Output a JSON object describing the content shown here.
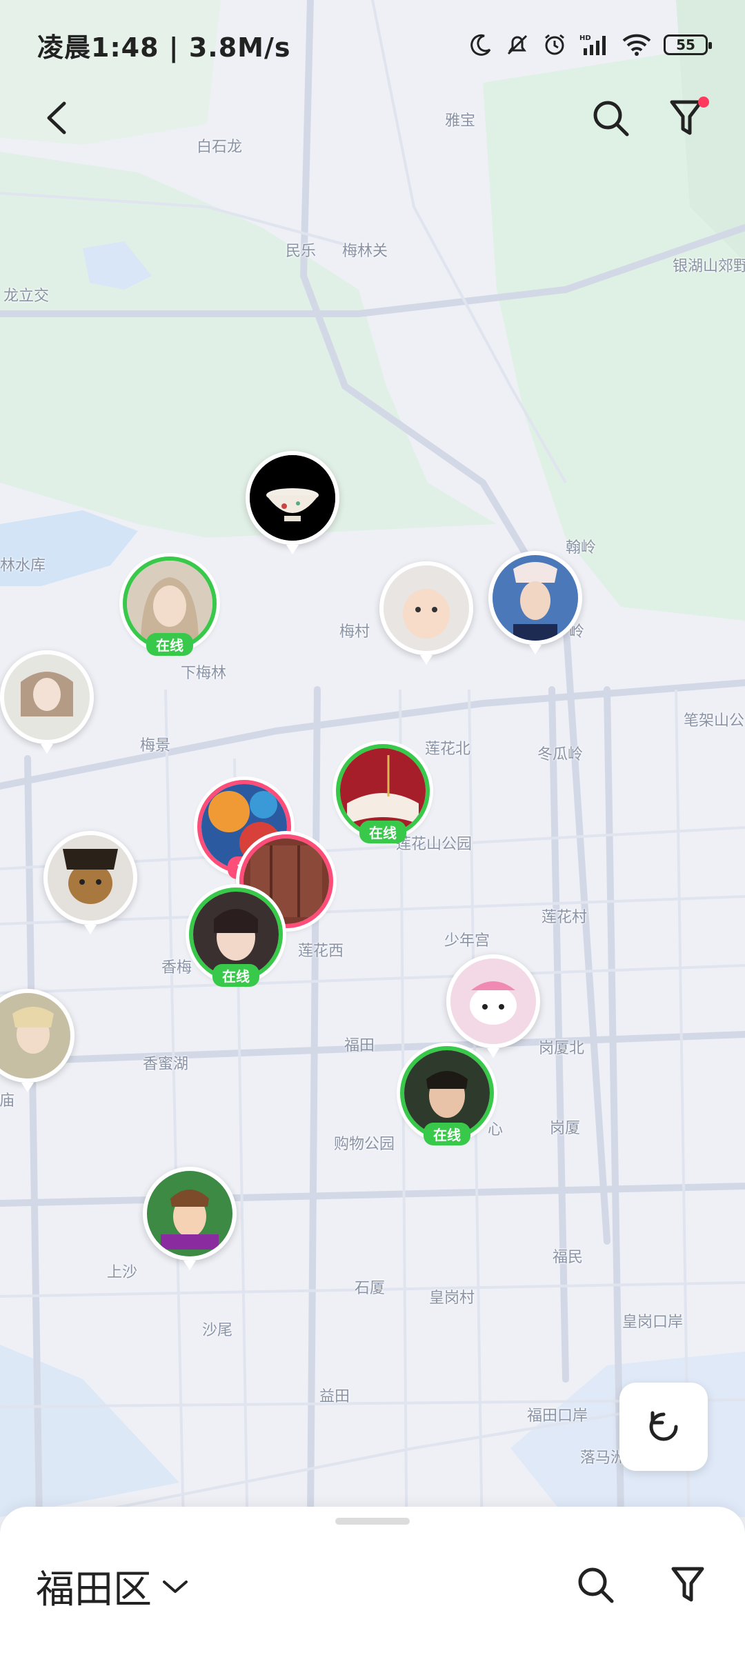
{
  "status_bar": {
    "time_speed": "凌晨1:48 | 3.8M/s",
    "battery": "55",
    "icons": [
      "moon-icon",
      "mute-bell-icon",
      "alarm-icon",
      "hd-signal-icon",
      "wifi-icon",
      "battery-icon"
    ]
  },
  "header": {
    "back_icon": "chevron-left-icon",
    "search_icon": "search-icon",
    "filter_icon": "filter-icon",
    "filter_has_notification": true
  },
  "map": {
    "labels": [
      "雅宝",
      "白石龙",
      "民乐",
      "梅林关",
      "银湖山郊野",
      "龙立交",
      "林水库",
      "翰岭",
      "梅村",
      "岭",
      "下梅林",
      "笔架山公",
      "梅景",
      "莲花北",
      "冬瓜岭",
      "莲花山公园",
      "莲花村",
      "少年宫",
      "莲花西",
      "香梅",
      "福田",
      "岗厦北",
      "香蜜湖",
      "庙",
      "心",
      "岗厦",
      "购物公园",
      "福民",
      "上沙",
      "石厦",
      "皇岗村",
      "沙尾",
      "皇岗口岸",
      "益田",
      "福田口岸",
      "落马洲"
    ],
    "markers": [
      {
        "status": null
      },
      {
        "status": "在线"
      },
      {
        "status": null
      },
      {
        "status": null
      },
      {
        "status": null
      },
      {
        "status": "在线"
      },
      {
        "status": "直播"
      },
      {
        "status": null
      },
      {
        "status": "在线"
      },
      {
        "status": "在线"
      },
      {
        "status": null
      },
      {
        "status": null
      },
      {
        "status": "在线"
      },
      {
        "status": null
      }
    ]
  },
  "refresh_icon": "refresh-icon",
  "bottom_sheet": {
    "district": "福田区",
    "dropdown_icon": "chevron-down-icon",
    "search_icon": "search-icon",
    "filter_icon": "filter-icon"
  },
  "colors": {
    "online": "#38c94a",
    "live": "#ff4d79",
    "map_background": "#eef0f6",
    "park_green": "#dff0e4",
    "notification": "#ff3a5c"
  }
}
